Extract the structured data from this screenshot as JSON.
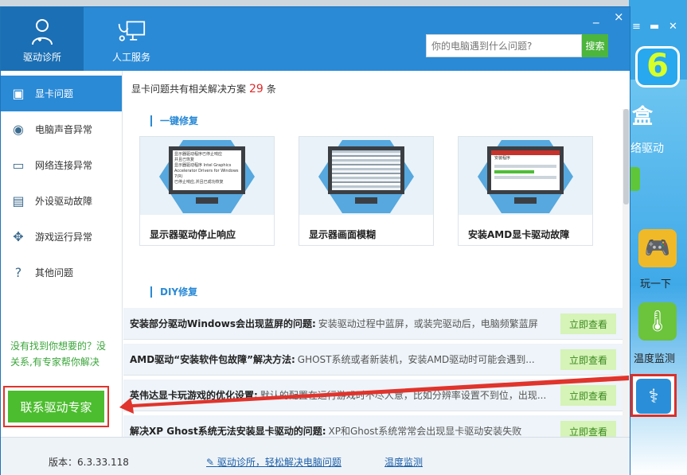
{
  "header": {
    "tabs": [
      {
        "label": "驱动诊所",
        "icon": "doctor-icon"
      },
      {
        "label": "人工服务",
        "icon": "service-icon"
      }
    ],
    "search": {
      "placeholder": "你的电脑遇到什么问题?",
      "button": "搜索"
    },
    "controls": {
      "minimize": "_",
      "close": "×"
    }
  },
  "sidebar": {
    "items": [
      {
        "label": "显卡问题",
        "icon": "display-card-icon"
      },
      {
        "label": "电脑声音异常",
        "icon": "sound-icon"
      },
      {
        "label": "网络连接异常",
        "icon": "network-icon"
      },
      {
        "label": "外设驱动故障",
        "icon": "peripheral-icon"
      },
      {
        "label": "游戏运行异常",
        "icon": "gamepad-icon"
      },
      {
        "label": "其他问题",
        "icon": "question-icon"
      }
    ],
    "help_text": "没有找到你想要的？没关系,有专家帮你解决",
    "contact_button": "联系驱动专家"
  },
  "content": {
    "summary_prefix": "显卡问题共有相关解决方案",
    "summary_count": "29",
    "summary_suffix": "条",
    "one_click_title": "一键修复",
    "cards": [
      {
        "title": "显示器驱动停止响应",
        "screen_text": [
          "显示器驱动程序已停止响应",
          "并且已恢复",
          "显示器驱动程序 Intel Graphics",
          "Accelerator Drivers for Windows 7(R)",
          "已停止响应,并且已成功恢复"
        ]
      },
      {
        "title": "显示器画面模糊"
      },
      {
        "title": "安装AMD显卡驱动故障",
        "screen_text": [
          "安装程序"
        ]
      }
    ],
    "diy_title": "DIY修复",
    "rows": [
      {
        "title": "安装部分驱动Windows会出现蓝屏的问题:",
        "desc": "安装驱动过程中蓝屏，或装完驱动后，电脑频繁蓝屏",
        "button": "立即查看"
      },
      {
        "title": "AMD驱动“安装软件包故障”解决方法:",
        "desc": "GHOST系统或者新装机，安装AMD驱动时可能会遇到...",
        "button": "立即查看"
      },
      {
        "title": "英伟达显卡玩游戏的优化设置:",
        "desc": "默认的配置在运行游戏时不尽人意，比如分辨率设置不到位，出现...",
        "button": "立即查看"
      },
      {
        "title": "解决XP Ghost系统无法安装显卡驱动的问题:",
        "desc": "XP和Ghost系统常常会出现显卡驱动安装失败",
        "button": "立即查看"
      }
    ]
  },
  "footer": {
    "version": "版本：6.3.33.118",
    "link1": "驱动诊所，轻松解决电脑问题",
    "link2": "温度监测"
  },
  "background_app": {
    "big_text": "盒",
    "sub_text": "络驱动",
    "logo_text": "6",
    "tiles": [
      {
        "label": "玩一下",
        "icon": "gamepad-icon"
      },
      {
        "label": "温度监测",
        "icon": "thermometer-icon"
      }
    ]
  },
  "colors": {
    "primary": "#2a8ad6",
    "green": "#4cbd2e",
    "alert_red": "#e0342c"
  }
}
